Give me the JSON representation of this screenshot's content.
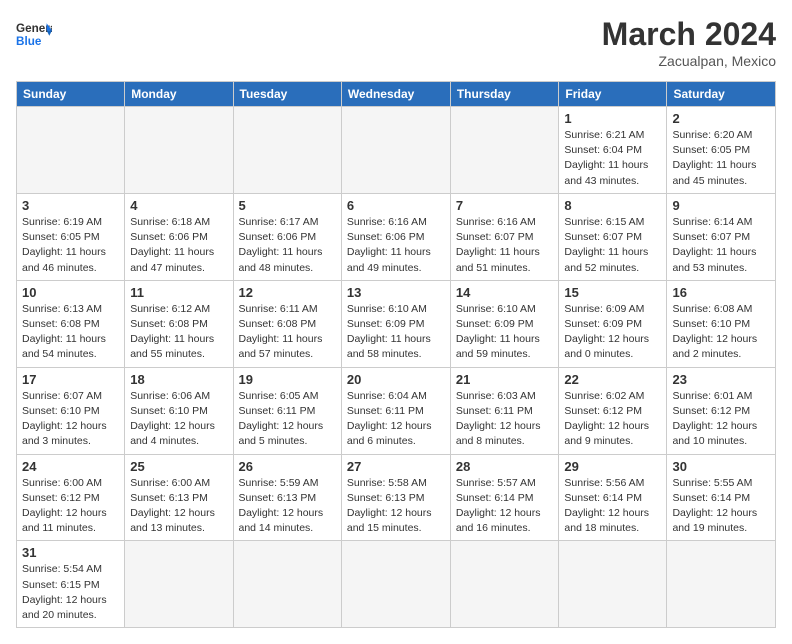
{
  "header": {
    "logo_general": "General",
    "logo_blue": "Blue",
    "month": "March 2024",
    "location": "Zacualpan, Mexico"
  },
  "days_of_week": [
    "Sunday",
    "Monday",
    "Tuesday",
    "Wednesday",
    "Thursday",
    "Friday",
    "Saturday"
  ],
  "weeks": [
    [
      {
        "day": "",
        "info": ""
      },
      {
        "day": "",
        "info": ""
      },
      {
        "day": "",
        "info": ""
      },
      {
        "day": "",
        "info": ""
      },
      {
        "day": "",
        "info": ""
      },
      {
        "day": "1",
        "info": "Sunrise: 6:21 AM\nSunset: 6:04 PM\nDaylight: 11 hours\nand 43 minutes."
      },
      {
        "day": "2",
        "info": "Sunrise: 6:20 AM\nSunset: 6:05 PM\nDaylight: 11 hours\nand 45 minutes."
      }
    ],
    [
      {
        "day": "3",
        "info": "Sunrise: 6:19 AM\nSunset: 6:05 PM\nDaylight: 11 hours\nand 46 minutes."
      },
      {
        "day": "4",
        "info": "Sunrise: 6:18 AM\nSunset: 6:06 PM\nDaylight: 11 hours\nand 47 minutes."
      },
      {
        "day": "5",
        "info": "Sunrise: 6:17 AM\nSunset: 6:06 PM\nDaylight: 11 hours\nand 48 minutes."
      },
      {
        "day": "6",
        "info": "Sunrise: 6:16 AM\nSunset: 6:06 PM\nDaylight: 11 hours\nand 49 minutes."
      },
      {
        "day": "7",
        "info": "Sunrise: 6:16 AM\nSunset: 6:07 PM\nDaylight: 11 hours\nand 51 minutes."
      },
      {
        "day": "8",
        "info": "Sunrise: 6:15 AM\nSunset: 6:07 PM\nDaylight: 11 hours\nand 52 minutes."
      },
      {
        "day": "9",
        "info": "Sunrise: 6:14 AM\nSunset: 6:07 PM\nDaylight: 11 hours\nand 53 minutes."
      }
    ],
    [
      {
        "day": "10",
        "info": "Sunrise: 6:13 AM\nSunset: 6:08 PM\nDaylight: 11 hours\nand 54 minutes."
      },
      {
        "day": "11",
        "info": "Sunrise: 6:12 AM\nSunset: 6:08 PM\nDaylight: 11 hours\nand 55 minutes."
      },
      {
        "day": "12",
        "info": "Sunrise: 6:11 AM\nSunset: 6:08 PM\nDaylight: 11 hours\nand 57 minutes."
      },
      {
        "day": "13",
        "info": "Sunrise: 6:10 AM\nSunset: 6:09 PM\nDaylight: 11 hours\nand 58 minutes."
      },
      {
        "day": "14",
        "info": "Sunrise: 6:10 AM\nSunset: 6:09 PM\nDaylight: 11 hours\nand 59 minutes."
      },
      {
        "day": "15",
        "info": "Sunrise: 6:09 AM\nSunset: 6:09 PM\nDaylight: 12 hours\nand 0 minutes."
      },
      {
        "day": "16",
        "info": "Sunrise: 6:08 AM\nSunset: 6:10 PM\nDaylight: 12 hours\nand 2 minutes."
      }
    ],
    [
      {
        "day": "17",
        "info": "Sunrise: 6:07 AM\nSunset: 6:10 PM\nDaylight: 12 hours\nand 3 minutes."
      },
      {
        "day": "18",
        "info": "Sunrise: 6:06 AM\nSunset: 6:10 PM\nDaylight: 12 hours\nand 4 minutes."
      },
      {
        "day": "19",
        "info": "Sunrise: 6:05 AM\nSunset: 6:11 PM\nDaylight: 12 hours\nand 5 minutes."
      },
      {
        "day": "20",
        "info": "Sunrise: 6:04 AM\nSunset: 6:11 PM\nDaylight: 12 hours\nand 6 minutes."
      },
      {
        "day": "21",
        "info": "Sunrise: 6:03 AM\nSunset: 6:11 PM\nDaylight: 12 hours\nand 8 minutes."
      },
      {
        "day": "22",
        "info": "Sunrise: 6:02 AM\nSunset: 6:12 PM\nDaylight: 12 hours\nand 9 minutes."
      },
      {
        "day": "23",
        "info": "Sunrise: 6:01 AM\nSunset: 6:12 PM\nDaylight: 12 hours\nand 10 minutes."
      }
    ],
    [
      {
        "day": "24",
        "info": "Sunrise: 6:00 AM\nSunset: 6:12 PM\nDaylight: 12 hours\nand 11 minutes."
      },
      {
        "day": "25",
        "info": "Sunrise: 6:00 AM\nSunset: 6:13 PM\nDaylight: 12 hours\nand 13 minutes."
      },
      {
        "day": "26",
        "info": "Sunrise: 5:59 AM\nSunset: 6:13 PM\nDaylight: 12 hours\nand 14 minutes."
      },
      {
        "day": "27",
        "info": "Sunrise: 5:58 AM\nSunset: 6:13 PM\nDaylight: 12 hours\nand 15 minutes."
      },
      {
        "day": "28",
        "info": "Sunrise: 5:57 AM\nSunset: 6:14 PM\nDaylight: 12 hours\nand 16 minutes."
      },
      {
        "day": "29",
        "info": "Sunrise: 5:56 AM\nSunset: 6:14 PM\nDaylight: 12 hours\nand 18 minutes."
      },
      {
        "day": "30",
        "info": "Sunrise: 5:55 AM\nSunset: 6:14 PM\nDaylight: 12 hours\nand 19 minutes."
      }
    ],
    [
      {
        "day": "31",
        "info": "Sunrise: 5:54 AM\nSunset: 6:15 PM\nDaylight: 12 hours\nand 20 minutes."
      },
      {
        "day": "",
        "info": ""
      },
      {
        "day": "",
        "info": ""
      },
      {
        "day": "",
        "info": ""
      },
      {
        "day": "",
        "info": ""
      },
      {
        "day": "",
        "info": ""
      },
      {
        "day": "",
        "info": ""
      }
    ]
  ]
}
